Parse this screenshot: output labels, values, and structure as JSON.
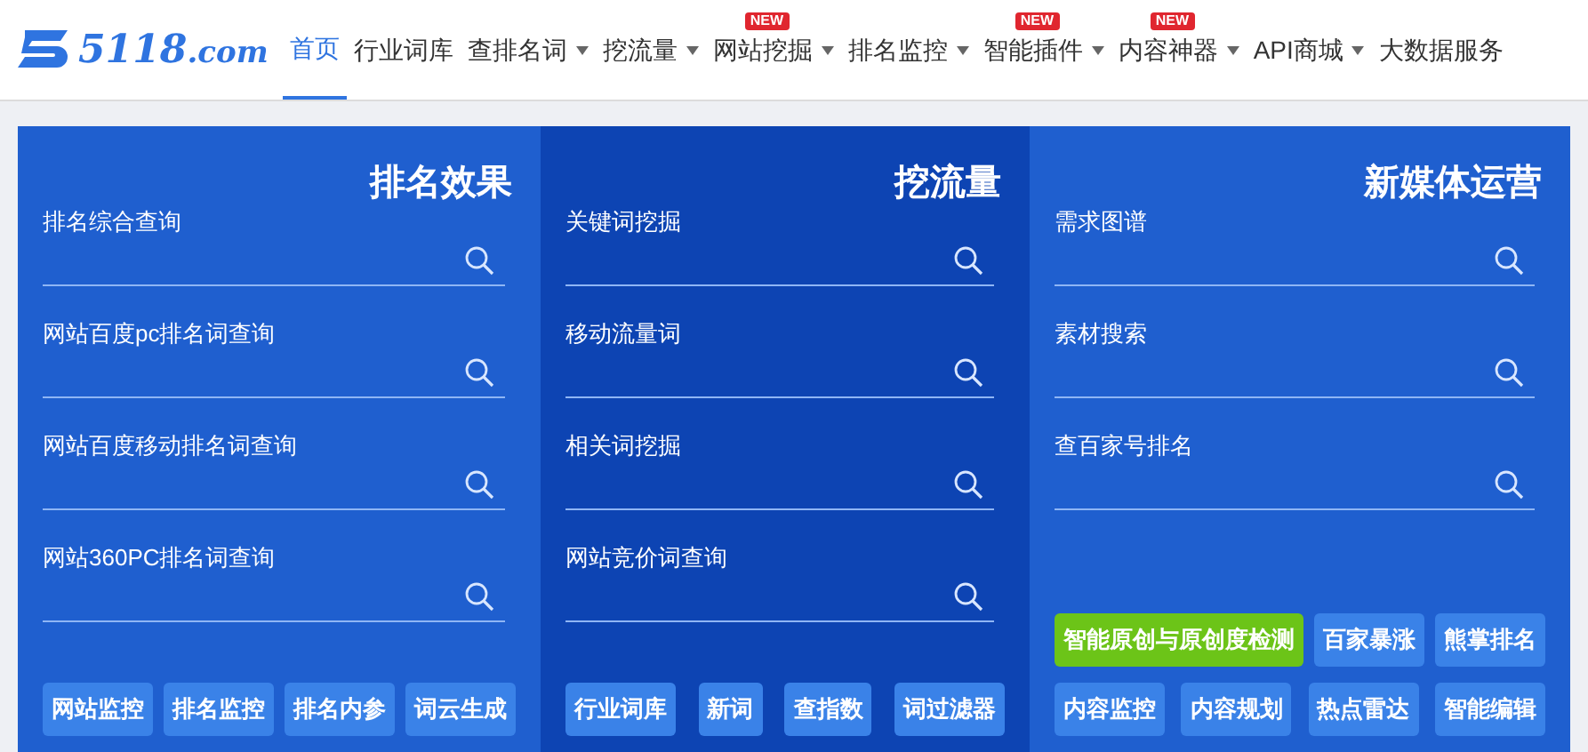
{
  "logo": {
    "text": "5118",
    "suffix": ".com"
  },
  "nav": [
    {
      "label": "首页",
      "selected": true,
      "dropdown": false
    },
    {
      "label": "行业词库",
      "selected": false,
      "dropdown": false
    },
    {
      "label": "查排名词",
      "selected": false,
      "dropdown": true
    },
    {
      "label": "挖流量",
      "selected": false,
      "dropdown": true
    },
    {
      "label": "网站挖掘",
      "selected": false,
      "dropdown": true,
      "badge": "NEW"
    },
    {
      "label": "排名监控",
      "selected": false,
      "dropdown": true
    },
    {
      "label": "智能插件",
      "selected": false,
      "dropdown": true,
      "badge": "NEW"
    },
    {
      "label": "内容神器",
      "selected": false,
      "dropdown": true,
      "badge": "NEW"
    },
    {
      "label": "API商城",
      "selected": false,
      "dropdown": true
    },
    {
      "label": "大数据服务",
      "selected": false,
      "dropdown": false
    }
  ],
  "columns": [
    {
      "title": "排名效果",
      "kind": "plain",
      "fields": [
        "排名综合查询",
        "网站百度pc排名词查询",
        "网站百度移动排名词查询",
        "网站360PC排名词查询"
      ],
      "button_rows": [
        [
          {
            "label": "网站监控",
            "kind": "normal"
          },
          {
            "label": "排名监控",
            "kind": "normal"
          },
          {
            "label": "排名内参",
            "kind": "normal"
          },
          {
            "label": "词云生成",
            "kind": "normal"
          }
        ]
      ]
    },
    {
      "title": "挖流量",
      "kind": "dark",
      "fields": [
        "关键词挖掘",
        "移动流量词",
        "相关词挖掘",
        "网站竞价词查询"
      ],
      "button_rows": [
        [
          {
            "label": "行业词库",
            "kind": "normal"
          },
          {
            "label": "新词",
            "kind": "normal"
          },
          {
            "label": "查指数",
            "kind": "normal"
          },
          {
            "label": "词过滤器",
            "kind": "normal"
          }
        ]
      ]
    },
    {
      "title": "新媒体运营",
      "kind": "plain",
      "fields": [
        "需求图谱",
        "素材搜索",
        "查百家号排名"
      ],
      "button_rows": [
        [
          {
            "label": "智能原创与原创度检测",
            "kind": "highlight"
          },
          {
            "label": "百家暴涨",
            "kind": "normal"
          },
          {
            "label": "熊掌排名",
            "kind": "normal"
          }
        ],
        [
          {
            "label": "内容监控",
            "kind": "normal"
          },
          {
            "label": "内容规划",
            "kind": "normal"
          },
          {
            "label": "热点雷达",
            "kind": "normal"
          },
          {
            "label": "智能编辑",
            "kind": "normal"
          }
        ]
      ]
    }
  ]
}
